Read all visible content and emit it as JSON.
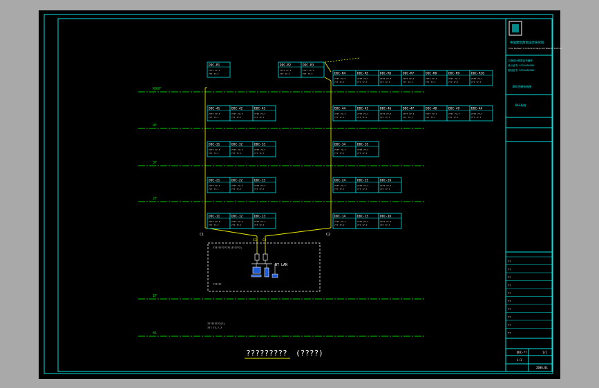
{
  "colors": {
    "background": "#000000",
    "viewport_bg": "#a9a9a9",
    "frame": "#00e5e5",
    "floor_line": "#00d000",
    "cable": "#e8e800",
    "text": "#ffffff"
  },
  "title_block": {
    "company": "中国建筑西南设计研究院",
    "company_en": "China Southwest Architectural Design and Research Institute",
    "approval_lines": [
      "工程设计资质证书编号",
      "设计证书  A151000286",
      "规划证书  A251000286"
    ],
    "project_label": "DDC控制系统图",
    "sub_label": "BAS系统"
  },
  "floors": [
    {
      "label": "ROOF"
    },
    {
      "label": "4F"
    },
    {
      "label": "3F"
    },
    {
      "label": "2F"
    },
    {
      "label": "1F"
    },
    {
      "label": "B1"
    }
  ],
  "rows": [
    {
      "left": [
        "DDC-R1"
      ],
      "mid": [
        "DDC-R2",
        "DDC-R3"
      ],
      "right": [
        "DDC-R4",
        "DDC-R5",
        "DDC-R6",
        "DDC-R7",
        "DDC-R8",
        "DDC-R9",
        "DDC-R10"
      ]
    },
    {
      "left": [
        "DDC-41",
        "DDC-42",
        "DDC-43"
      ],
      "right": [
        "DDC-44",
        "DDC-45",
        "DDC-46",
        "DDC-47",
        "DDC-48",
        "DDC-49",
        "DDC-4A"
      ]
    },
    {
      "left": [
        "DDC-31",
        "DDC-32",
        "DDC-33"
      ],
      "right": [
        "DDC-34",
        "DDC-35"
      ]
    },
    {
      "left": [
        "DDC-21",
        "DDC-22",
        "DDC-23"
      ],
      "right": [
        "DDC-24",
        "DDC-25",
        "DDC-26"
      ]
    },
    {
      "left": [
        "DDC-11",
        "DDC-12",
        "DDC-13"
      ],
      "right": [
        "DDC-14",
        "DDC-15",
        "DDC-16"
      ]
    }
  ],
  "ddc_line": "???? ??-?",
  "ddc_line2": "??? ??-?",
  "bus_labels": [
    "C1",
    "C2"
  ],
  "control_room": {
    "title": "????????????(??????)",
    "network_label": "NT LAN",
    "bottom_label": "??????",
    "bus_tag_a": "C1",
    "bus_tag_b": "C2"
  },
  "b1_note": [
    "?????????(?)",
    "???  ??-?-?"
  ],
  "drawing_title": "?????????",
  "drawing_subtitle": "(????)",
  "revision_rows": [
    "??",
    "??",
    "??",
    "??",
    "??",
    "??",
    "??",
    "??",
    "??",
    "??"
  ],
  "sheet": {
    "drawing_no": "DDC-??",
    "sheet_no": "1/1",
    "scale": "1:1",
    "date": "2008.01"
  }
}
